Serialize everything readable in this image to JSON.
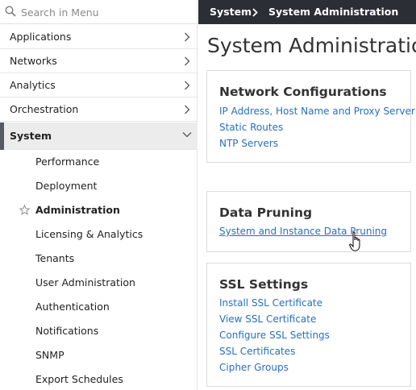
{
  "search": {
    "placeholder": "Search in Menu"
  },
  "sidebar": {
    "items": [
      {
        "label": "Applications"
      },
      {
        "label": "Networks"
      },
      {
        "label": "Analytics"
      },
      {
        "label": "Orchestration"
      },
      {
        "label": "System"
      }
    ],
    "system_subitems": [
      {
        "label": "Performance"
      },
      {
        "label": "Deployment"
      },
      {
        "label": "Administration"
      },
      {
        "label": "Licensing & Analytics"
      },
      {
        "label": "Tenants"
      },
      {
        "label": "User Administration"
      },
      {
        "label": "Authentication"
      },
      {
        "label": "Notifications"
      },
      {
        "label": "SNMP"
      },
      {
        "label": "Export Schedules"
      }
    ]
  },
  "breadcrumb": {
    "first": "System",
    "second": "System Administration"
  },
  "page": {
    "title": "System Administration"
  },
  "cards": {
    "network": {
      "title": "Network Configurations",
      "links": [
        "IP Address, Host Name and Proxy Server",
        "Static Routes",
        "NTP Servers"
      ]
    },
    "pruning": {
      "title": "Data Pruning",
      "links": [
        "System and Instance Data Pruning"
      ]
    },
    "ssl": {
      "title": "SSL Settings",
      "links": [
        "Install SSL Certificate",
        "View SSL Certificate",
        "Configure SSL Settings",
        "SSL Certificates",
        "Cipher Groups"
      ]
    }
  },
  "colors": {
    "link": "#2a6ebd",
    "topbar": "#2b2e35",
    "active_bar": "#565b63"
  }
}
